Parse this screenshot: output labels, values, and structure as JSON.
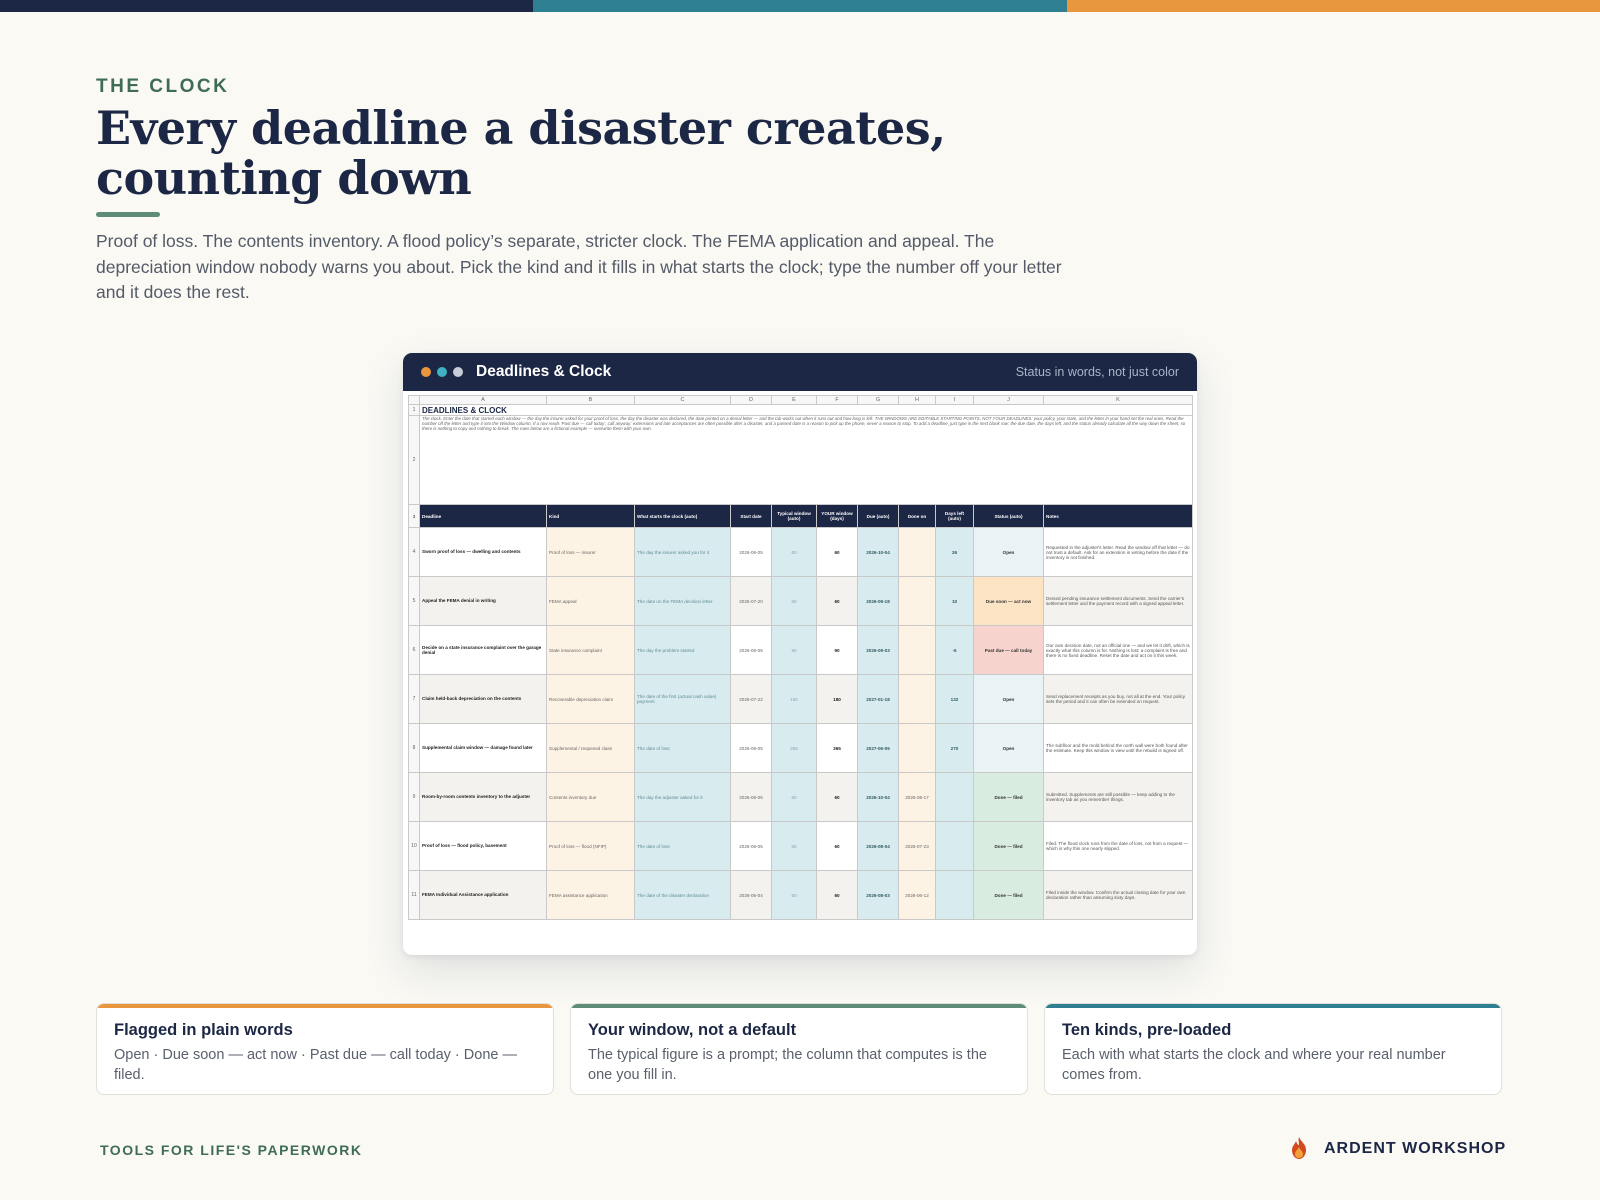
{
  "eyebrow": "THE CLOCK",
  "title": "Every deadline a disaster creates, counting down",
  "intro": "Proof of loss. The contents inventory. A flood policy’s separate, stricter clock. The FEMA application and appeal. The depreciation window nobody warns you about. Pick the kind and it fills in what starts the clock; type the number off your letter and it does the rest.",
  "window": {
    "title": "Deadlines & Clock",
    "status": "Status in words, not just color"
  },
  "sheet": {
    "columns": [
      "A",
      "B",
      "C",
      "D",
      "E",
      "F",
      "G",
      "H",
      "I",
      "J",
      "K"
    ],
    "title": "DEADLINES & CLOCK",
    "description": "The clock. Enter the date that started each window — the day the insurer asked for your proof of loss, the day the disaster was declared, the date printed on a denial letter — and the tab works out when it runs out and how long is left. THE WINDOWS ARE EDITABLE STARTING POINTS, NOT YOUR DEADLINES: your policy, your state, and the letter in your hand set the real ones. Read the number off the letter and type it into the Window column. If a row reads 'Past due — call today', call anyway: extensions and late acceptances are often possible after a disaster, and a passed date is a reason to pick up the phone, never a reason to stop. To add a deadline, just type in the next blank row: the due date, the days left, and the status already calculate all the way down the sheet, so there is nothing to copy and nothing to break. The rows below are a fictional example — overwrite them with your own.",
    "headers": [
      "Deadline",
      "Kind",
      "What starts the clock (auto)",
      "Start date",
      "Typical window (auto)",
      "YOUR window (days)",
      "Due (auto)",
      "Done on",
      "Days left (auto)",
      "Status (auto)",
      "Notes"
    ],
    "rows": [
      {
        "num": "4",
        "deadline": "Sworn proof of loss — dwelling and contents",
        "kind": "Proof of loss — insurer",
        "starts": "The day the insurer asked you for it",
        "start": "2026-06-05",
        "typical": "60",
        "yours": "60",
        "due": "2026-10-04",
        "done": "",
        "left": "26",
        "status": "Open",
        "notes": "Requested in the adjuster's letter. Read the window off that letter — do not trust a default. Ask for an extension in writing before the date if the inventory is not finished."
      },
      {
        "num": "5",
        "deadline": "Appeal the FEMA denial in writing",
        "kind": "FEMA appeal",
        "starts": "The date on the FEMA decision letter",
        "start": "2026-07-20",
        "typical": "60",
        "yours": "60",
        "due": "2026-09-18",
        "done": "",
        "left": "10",
        "status": "Due soon — act now",
        "notes": "Denied pending insurance settlement documents. Send the carrier's settlement letter and the payment record with a signed appeal letter."
      },
      {
        "num": "6",
        "deadline": "Decide on a state insurance complaint over the garage denial",
        "kind": "State insurance complaint",
        "starts": "The day the problem started",
        "start": "2026-06-05",
        "typical": "90",
        "yours": "90",
        "due": "2026-09-03",
        "done": "",
        "left": "-5",
        "status": "Past due — call today",
        "notes": "Our own decision date, not an official one — and we let it drift, which is exactly what this column is for. Nothing is lost: a complaint is free and there is no fixed deadline. Reset the date and act on it this week."
      },
      {
        "num": "7",
        "deadline": "Claim held-back depreciation on the contents",
        "kind": "Recoverable depreciation claim",
        "starts": "The date of the first (actual cash value) payment",
        "start": "2026-07-22",
        "typical": "180",
        "yours": "180",
        "due": "2027-01-18",
        "done": "",
        "left": "132",
        "status": "Open",
        "notes": "Send replacement receipts as you buy, not all at the end. Your policy sets the period and it can often be extended on request."
      },
      {
        "num": "8",
        "deadline": "Supplemental claim window — damage found later",
        "kind": "Supplemental / reopened claim",
        "starts": "The date of loss",
        "start": "2026-06-05",
        "typical": "365",
        "yours": "365",
        "due": "2027-06-05",
        "done": "",
        "left": "270",
        "status": "Open",
        "notes": "The subfloor and the mold behind the north wall were both found after the estimate. Keep this window in view until the rebuild is signed off."
      },
      {
        "num": "9",
        "deadline": "Room-by-room contents inventory to the adjuster",
        "kind": "Contents inventory due",
        "starts": "The day the adjuster asked for it",
        "start": "2026-08-05",
        "typical": "60",
        "yours": "60",
        "due": "2026-10-04",
        "done": "2026-08-17",
        "left": "",
        "status": "Done — filed",
        "notes": "Submitted. Supplements are still possible — keep adding to the inventory tab as you remember things."
      },
      {
        "num": "10",
        "deadline": "Proof of loss — flood policy, basement",
        "kind": "Proof of loss — flood (NFIP)",
        "starts": "The date of loss",
        "start": "2026-06-05",
        "typical": "60",
        "yours": "60",
        "due": "2026-08-04",
        "done": "2026-07-23",
        "left": "",
        "status": "Done — filed",
        "notes": "Filed. The flood clock runs from the date of loss, not from a request — which is why this one nearly slipped."
      },
      {
        "num": "11",
        "deadline": "FEMA Individual Assistance application",
        "kind": "FEMA assistance application",
        "starts": "The date of the disaster declaration",
        "start": "2026-06-04",
        "typical": "60",
        "yours": "60",
        "due": "2026-08-03",
        "done": "2026-06-12",
        "left": "",
        "status": "Done — filed",
        "notes": "Filed inside the window. Confirm the actual closing date for your own declaration rather than assuming sixty days."
      }
    ]
  },
  "cards": [
    {
      "title": "Flagged in plain words",
      "text": "Open · Due soon — act now · Past due — call today · Done — filed."
    },
    {
      "title": "Your window, not a default",
      "text": "The typical figure is a prompt; the column that computes is the one you fill in."
    },
    {
      "title": "Ten kinds, pre-loaded",
      "text": "Each with what starts the clock and where your real number comes from."
    }
  ],
  "footer": {
    "left": "TOOLS FOR LIFE'S PAPERWORK",
    "brand": "ARDENT WORKSHOP",
    "brand_icon": "flame-icon"
  },
  "colors": {
    "navy": "#1c2745",
    "teal": "#2e7f92",
    "orange": "#e8973f",
    "green": "#5f8c76",
    "background": "#faf9f4"
  }
}
